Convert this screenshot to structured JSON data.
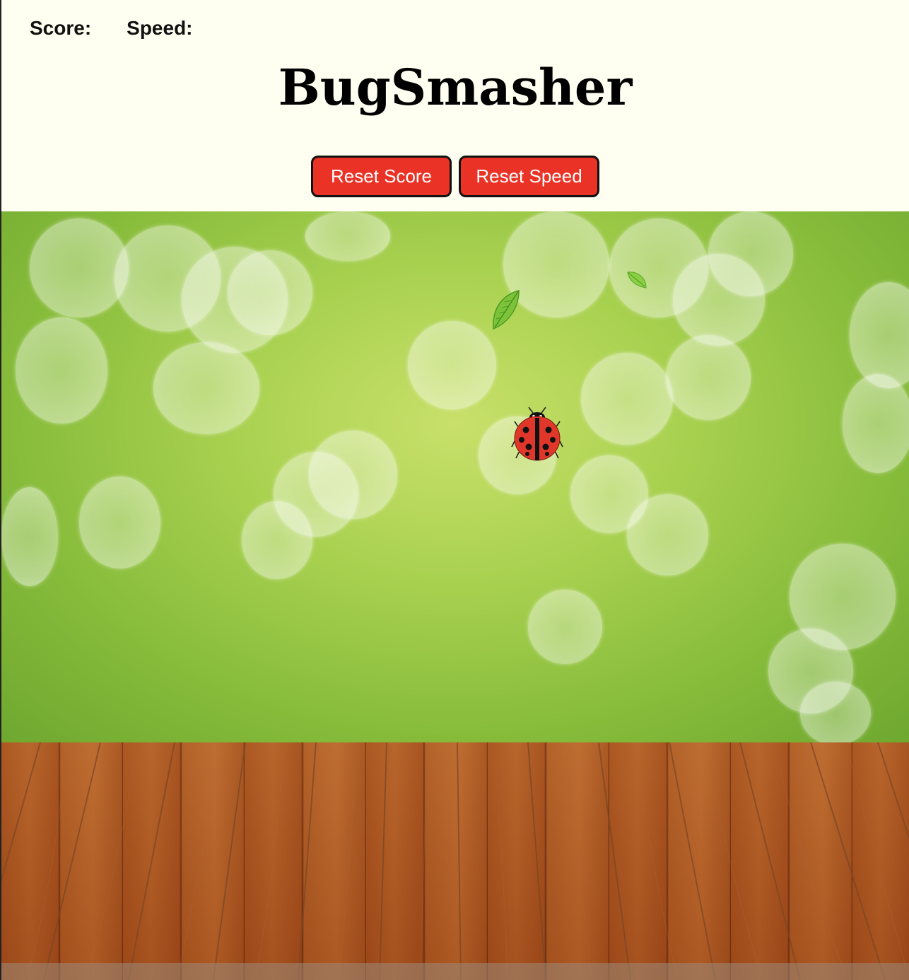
{
  "stats": {
    "score_label": "Score:",
    "score_value": "",
    "speed_label": "Speed:",
    "speed_value": ""
  },
  "title": "BugSmasher",
  "buttons": {
    "reset_score": "Reset Score",
    "reset_speed": "Reset Speed"
  },
  "colors": {
    "page_bg": "#fefff0",
    "button_bg": "#ea3326",
    "button_border": "#111111",
    "ladybug_red": "#e0372a"
  },
  "icons": {
    "bug": "ladybug-icon",
    "leaf": "leaf-icon"
  }
}
